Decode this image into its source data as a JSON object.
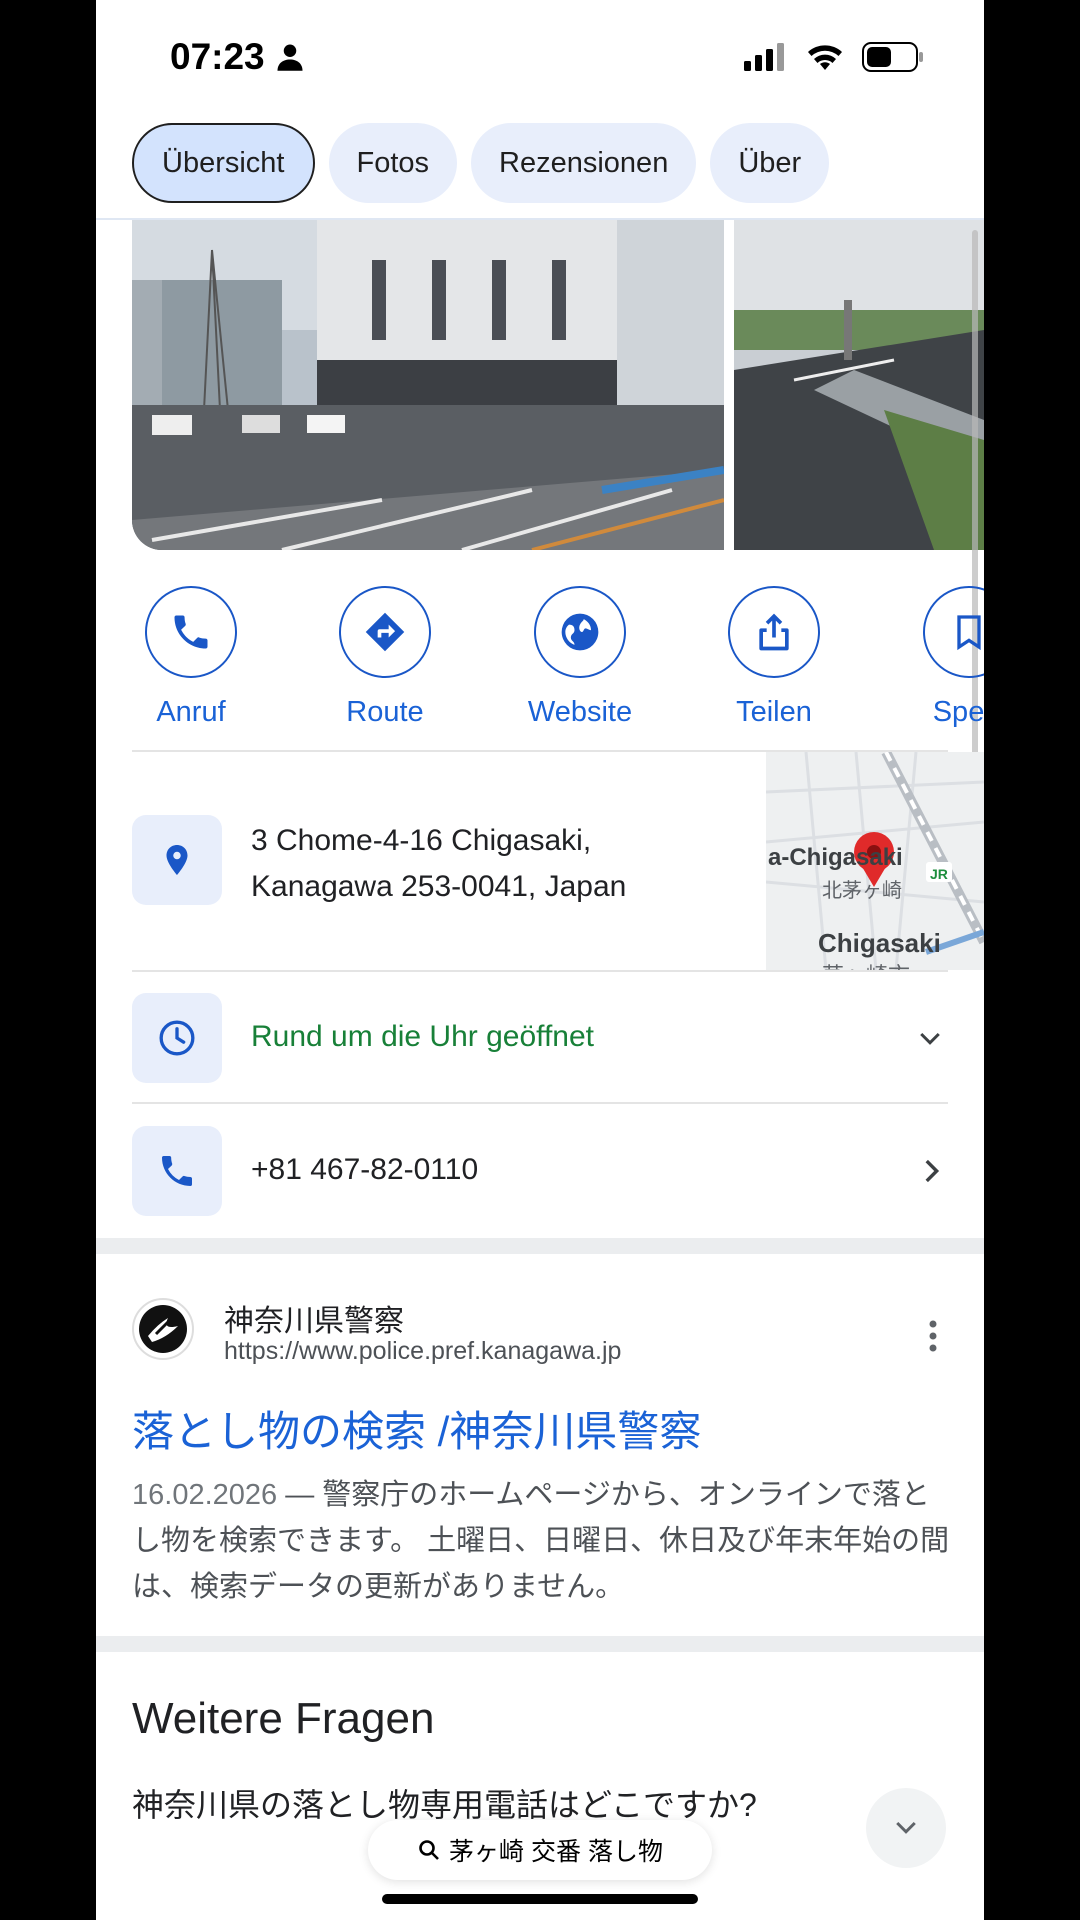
{
  "status_bar": {
    "time": "07:23"
  },
  "tabs": [
    {
      "label": "Übersicht",
      "active": true
    },
    {
      "label": "Fotos",
      "active": false
    },
    {
      "label": "Rezensionen",
      "active": false
    },
    {
      "label": "Über",
      "active": false
    }
  ],
  "actions": [
    {
      "label": "Anruf",
      "icon": "phone-icon"
    },
    {
      "label": "Route",
      "icon": "directions-icon"
    },
    {
      "label": "Website",
      "icon": "globe-icon"
    },
    {
      "label": "Teilen",
      "icon": "share-icon"
    },
    {
      "label": "Speic",
      "icon": "bookmark-icon"
    }
  ],
  "address": {
    "line1": "3 Chome-4-16 Chigasaki,",
    "line2": "Kanagawa 253-0041, Japan"
  },
  "map": {
    "label1": "a-Chigasaki",
    "label2": "北茅ヶ崎",
    "label3": "Chigasaki",
    "label4": "茅ヶ崎市",
    "jr": "JR"
  },
  "hours": {
    "text": "Rund um die Uhr geöffnet"
  },
  "phone": {
    "number": "+81 467-82-0110"
  },
  "result": {
    "site_name": "神奈川県警察",
    "url": "https://www.police.pref.kanagawa.jp",
    "title": "落とし物の検索 /神奈川県警察",
    "date": "16.02.2026",
    "snippet": " — 警察庁のホームページから、オンラインで落とし物を検索できます。 土曜日、日曜日、休日及び年末年始の間は、検索データの更新がありません。"
  },
  "faq": {
    "title": "Weitere Fragen",
    "question": "神奈川県の落とし物専用電話はどこですか?"
  },
  "search_pill": {
    "query": "茅ヶ崎 交番 落し物"
  },
  "colors": {
    "accent": "#1a62d6",
    "open": "#188038",
    "chip_bg": "#e8eefb"
  }
}
